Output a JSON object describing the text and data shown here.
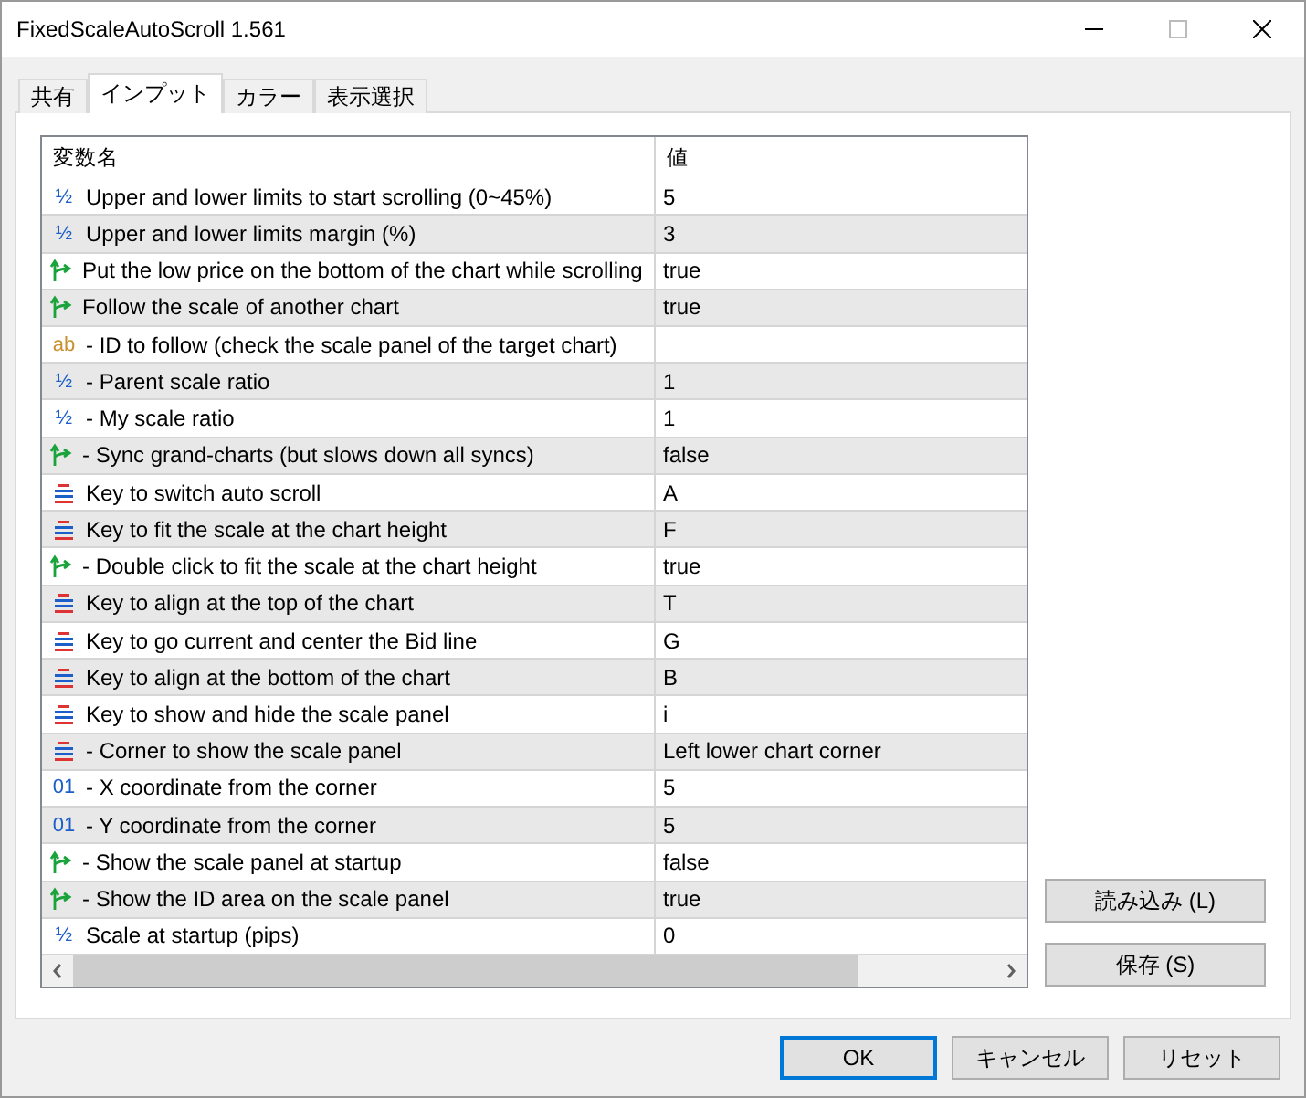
{
  "window": {
    "title": "FixedScaleAutoScroll 1.561"
  },
  "tabs": [
    {
      "label": "共有",
      "selected": false
    },
    {
      "label": "インプット",
      "selected": true
    },
    {
      "label": "カラー",
      "selected": false
    },
    {
      "label": "表示選択",
      "selected": false
    }
  ],
  "table": {
    "columns": [
      "変数名",
      "値"
    ],
    "rows": [
      {
        "kind": "double",
        "glyph": "½",
        "name": "Upper and lower limits to start scrolling (0~45%)",
        "value": "5"
      },
      {
        "kind": "double",
        "glyph": "½",
        "name": "Upper and lower limits margin (%)",
        "value": "3"
      },
      {
        "kind": "bool",
        "name": "Put the low price on the bottom of the chart while scrolling",
        "value": "true"
      },
      {
        "kind": "bool",
        "name": "Follow the scale of another chart",
        "value": "true"
      },
      {
        "kind": "string",
        "glyph": "ab",
        "name": "- ID to follow (check the scale panel of the target chart)",
        "value": ""
      },
      {
        "kind": "double",
        "glyph": "½",
        "name": "- Parent scale ratio",
        "value": "1"
      },
      {
        "kind": "double",
        "glyph": "½",
        "name": "- My scale ratio",
        "value": "1"
      },
      {
        "kind": "bool",
        "name": "- Sync grand-charts (but slows down all syncs)",
        "value": "false"
      },
      {
        "kind": "enum",
        "name": "Key to switch auto scroll",
        "value": "A"
      },
      {
        "kind": "enum",
        "name": "Key to fit the scale at the chart height",
        "value": "F"
      },
      {
        "kind": "bool",
        "name": "- Double click to fit the scale at the chart height",
        "value": "true"
      },
      {
        "kind": "enum",
        "name": "Key to align at the top of the chart",
        "value": "T"
      },
      {
        "kind": "enum",
        "name": "Key to go current and center the Bid line",
        "value": "G"
      },
      {
        "kind": "enum",
        "name": "Key to align at the bottom of the chart",
        "value": "B"
      },
      {
        "kind": "enum",
        "name": "Key to show and hide the scale panel",
        "value": "i"
      },
      {
        "kind": "enum",
        "name": "- Corner to show the scale panel",
        "value": "Left lower chart corner"
      },
      {
        "kind": "int",
        "glyph": "01",
        "name": "- X coordinate from the corner",
        "value": "5"
      },
      {
        "kind": "int",
        "glyph": "01",
        "name": "- Y coordinate from the corner",
        "value": "5"
      },
      {
        "kind": "bool",
        "name": "- Show the scale panel at startup",
        "value": "false"
      },
      {
        "kind": "bool",
        "name": "- Show the ID area on the scale panel",
        "value": "true"
      },
      {
        "kind": "double",
        "glyph": "½",
        "name": "Scale at startup (pips)",
        "value": "0"
      }
    ]
  },
  "side_buttons": [
    "読み込み (L)",
    "保存 (S)"
  ],
  "footer_buttons": [
    {
      "label": "OK",
      "default": true
    },
    {
      "label": "キャンセル",
      "default": false
    },
    {
      "label": "リセット",
      "default": false
    }
  ]
}
